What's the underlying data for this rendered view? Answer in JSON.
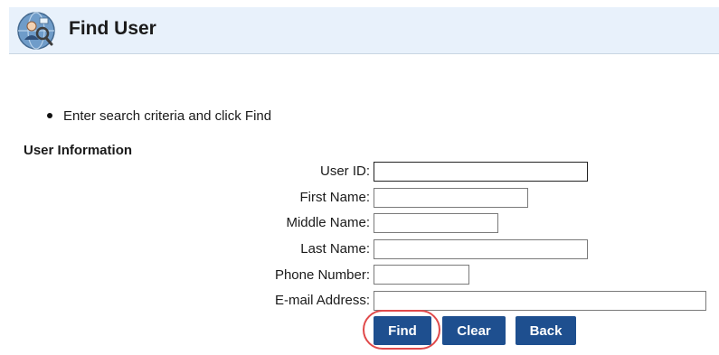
{
  "header": {
    "title": "Find User",
    "icon": "user-search-globe-icon"
  },
  "instructions": {
    "items": [
      "Enter search criteria and click Find"
    ]
  },
  "section": {
    "title": "User Information"
  },
  "form": {
    "fields": [
      {
        "label": "User ID:",
        "value": ""
      },
      {
        "label": "First Name:",
        "value": ""
      },
      {
        "label": "Middle Name:",
        "value": ""
      },
      {
        "label": "Last Name:",
        "value": ""
      },
      {
        "label": "Phone Number:",
        "value": ""
      },
      {
        "label": "E-mail Address:",
        "value": ""
      }
    ]
  },
  "buttons": {
    "find": "Find",
    "clear": "Clear",
    "back": "Back"
  },
  "colors": {
    "header_bg": "#e8f1fb",
    "button_bg": "#1e4f8f",
    "highlight": "#e0494a"
  }
}
